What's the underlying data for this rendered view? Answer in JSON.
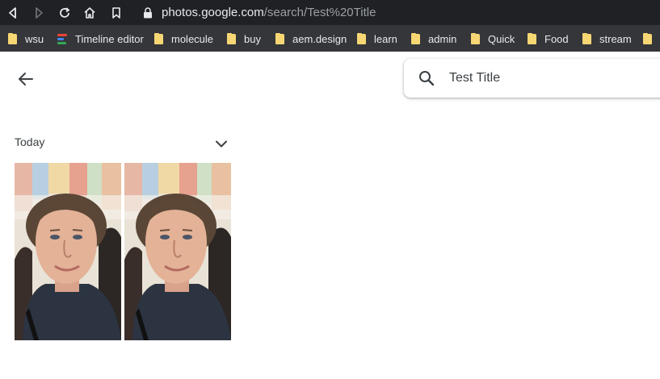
{
  "browser": {
    "url_host": "photos.google.com",
    "url_path": "/search/Test%20Title"
  },
  "bookmarks": [
    {
      "label": "wsu",
      "icon": "folder-icon"
    },
    {
      "label": "Timeline editor",
      "icon": "timeline-app-icon"
    },
    {
      "label": "molecule",
      "icon": "folder-icon"
    },
    {
      "label": "buy",
      "icon": "folder-icon"
    },
    {
      "label": "aem.design",
      "icon": "folder-icon"
    },
    {
      "label": "learn",
      "icon": "folder-icon"
    },
    {
      "label": "admin",
      "icon": "folder-icon"
    },
    {
      "label": "Quick",
      "icon": "folder-icon"
    },
    {
      "label": "Food",
      "icon": "folder-icon"
    },
    {
      "label": "stream",
      "icon": "folder-icon"
    }
  ],
  "search": {
    "value": "Test Title"
  },
  "results": {
    "section_title": "Today",
    "photos": [
      {
        "subject": "portrait photo"
      },
      {
        "subject": "portrait photo"
      }
    ]
  },
  "colors": {
    "topbar": "#202124",
    "bookmarks_bar": "#35363a",
    "folder": "#f7d774",
    "text": "#3c4043"
  }
}
